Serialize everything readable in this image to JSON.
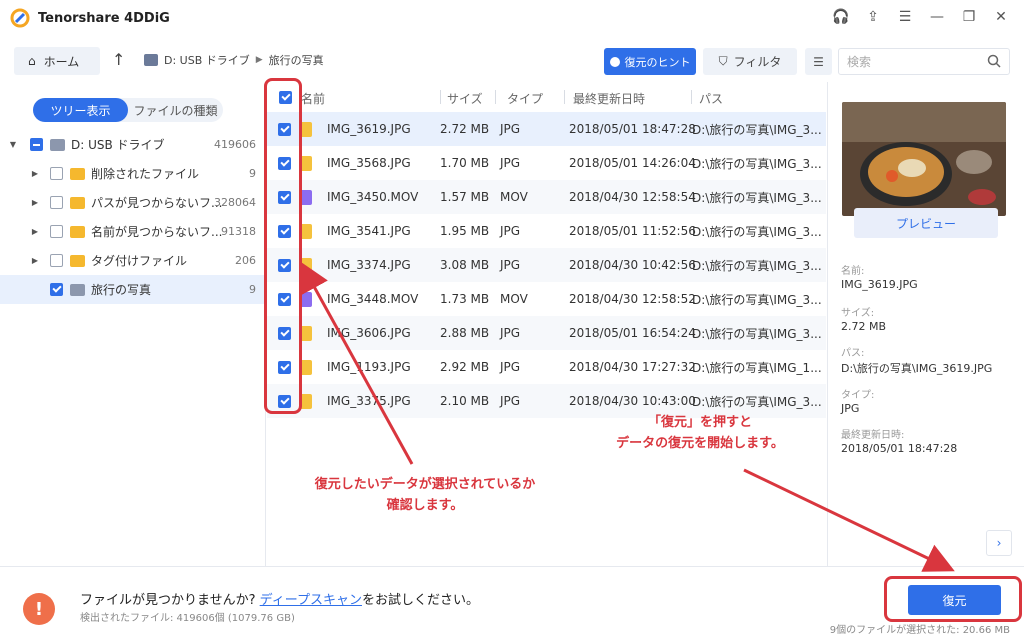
{
  "window": {
    "title": "Tenorshare 4DDiG"
  },
  "toolbar": {
    "home_label": "ホーム",
    "breadcrumb": [
      "D: USB ドライブ",
      "旅行の写真"
    ],
    "hint_label": "復元のヒント",
    "filter_label": "フィルタ",
    "search_placeholder": "検索"
  },
  "sidebar": {
    "tabs": [
      {
        "label": "ツリー表示"
      },
      {
        "label": "ファイルの種類"
      }
    ],
    "items": [
      {
        "label": "D: USB ドライブ",
        "count": "419606"
      },
      {
        "label": "削除されたファイル",
        "count": "9"
      },
      {
        "label": "パスが見つからないフ...",
        "count": "328064"
      },
      {
        "label": "名前が見つからないフ...",
        "count": "91318"
      },
      {
        "label": "タグ付けファイル",
        "count": "206"
      },
      {
        "label": "旅行の写真",
        "count": "9"
      }
    ]
  },
  "table": {
    "headers": [
      "名前",
      "サイズ",
      "タイプ",
      "最終更新日時",
      "パス"
    ],
    "rows": [
      {
        "name": "IMG_3619.JPG",
        "size": "2.72 MB",
        "type": "JPG",
        "modified": "2018/05/01 18:47:28",
        "path": "D:\\旅行の写真\\IMG_3..."
      },
      {
        "name": "IMG_3568.JPG",
        "size": "1.70 MB",
        "type": "JPG",
        "modified": "2018/05/01 14:26:04",
        "path": "D:\\旅行の写真\\IMG_3..."
      },
      {
        "name": "IMG_3450.MOV",
        "size": "1.57 MB",
        "type": "MOV",
        "modified": "2018/04/30 12:58:54",
        "path": "D:\\旅行の写真\\IMG_3..."
      },
      {
        "name": "IMG_3541.JPG",
        "size": "1.95 MB",
        "type": "JPG",
        "modified": "2018/05/01 11:52:56",
        "path": "D:\\旅行の写真\\IMG_3..."
      },
      {
        "name": "IMG_3374.JPG",
        "size": "3.08 MB",
        "type": "JPG",
        "modified": "2018/04/30 10:42:56",
        "path": "D:\\旅行の写真\\IMG_3..."
      },
      {
        "name": "IMG_3448.MOV",
        "size": "1.73 MB",
        "type": "MOV",
        "modified": "2018/04/30 12:58:52",
        "path": "D:\\旅行の写真\\IMG_3..."
      },
      {
        "name": "IMG_3606.JPG",
        "size": "2.88 MB",
        "type": "JPG",
        "modified": "2018/05/01 16:54:24",
        "path": "D:\\旅行の写真\\IMG_3..."
      },
      {
        "name": "IMG_1193.JPG",
        "size": "2.92 MB",
        "type": "JPG",
        "modified": "2018/04/30 17:27:32",
        "path": "D:\\旅行の写真\\IMG_1..."
      },
      {
        "name": "IMG_3375.JPG",
        "size": "2.10 MB",
        "type": "JPG",
        "modified": "2018/04/30 10:43:00",
        "path": "D:\\旅行の写真\\IMG_3..."
      }
    ]
  },
  "preview": {
    "button_label": "プレビュー",
    "name_label": "名前:",
    "name_value": "IMG_3619.JPG",
    "size_label": "サイズ:",
    "size_value": "2.72 MB",
    "path_label": "パス:",
    "path_value": "D:\\旅行の写真\\IMG_3619.JPG",
    "type_label": "タイプ:",
    "type_value": "JPG",
    "modified_label": "最終更新日時:",
    "modified_value": "2018/05/01 18:47:28"
  },
  "annotations": {
    "left_line1": "復元したいデータが選択されているか",
    "left_line2": "確認します。",
    "right_line1": "「復元」を押すと",
    "right_line2": "データの復元を開始します。"
  },
  "bottom": {
    "msg_prefix": "ファイルが見つかりませんか?",
    "msg_link": "ディープスキャン",
    "msg_suffix": "をお試しください。",
    "found_text": "検出されたファイル: 419606個 (1079.76 GB)",
    "recover_label": "復元",
    "selection_summary": "9個のファイルが選択された:   20.66 MB"
  },
  "colors": {
    "accent": "#2f6fe8",
    "annotation": "#d9363e",
    "warning": "#ef6f4a"
  }
}
